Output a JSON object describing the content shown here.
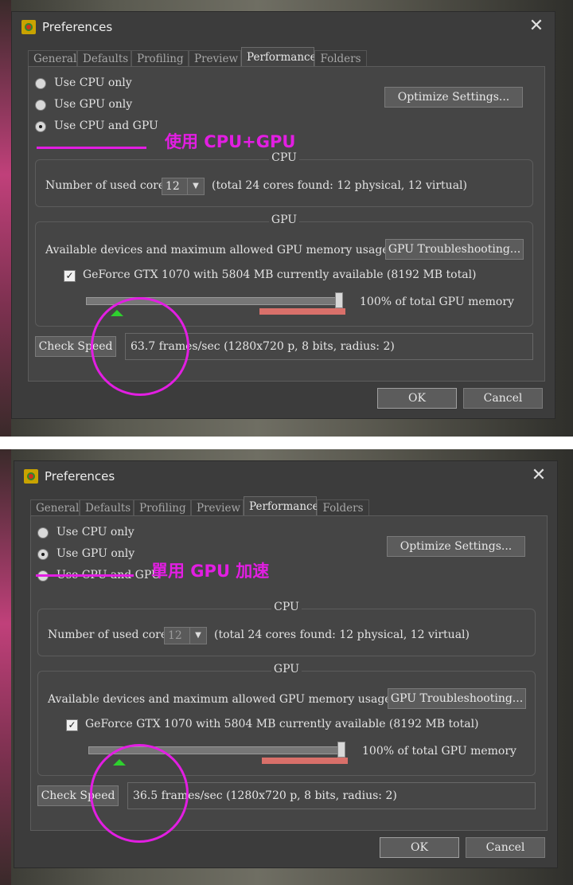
{
  "panels": [
    {
      "title": "Preferences",
      "tabs": [
        "General",
        "Defaults",
        "Profiling",
        "Preview",
        "Performance",
        "Folders"
      ],
      "active_tab": "Performance",
      "radios": [
        "Use CPU only",
        "Use GPU only",
        "Use CPU and GPU"
      ],
      "selected_radio": 2,
      "optimize_label": "Optimize Settings...",
      "cpu_group_title": "CPU",
      "cores_label": "Number of used cores:",
      "cores_value": "12",
      "cores_enabled": true,
      "cores_info": "(total 24 cores found: 12 physical, 12 virtual)",
      "gpu_group_title": "GPU",
      "devices_label": "Available devices and maximum allowed GPU memory usage:",
      "troubleshoot_label": "GPU Troubleshooting...",
      "gpu_device_label": "GeForce GTX 1070 with 5804 MB currently available (8192 MB total)",
      "gpu_device_checked": true,
      "memory_percent": 100,
      "memory_label": "100% of total GPU memory",
      "check_speed_label": "Check Speed",
      "speed_result": "63.7 frames/sec (1280x720 p, 8 bits, radius: 2)",
      "ok_label": "OK",
      "cancel_label": "Cancel",
      "annotation": "使用 CPU+GPU"
    },
    {
      "title": "Preferences",
      "tabs": [
        "General",
        "Defaults",
        "Profiling",
        "Preview",
        "Performance",
        "Folders"
      ],
      "active_tab": "Performance",
      "radios": [
        "Use CPU only",
        "Use GPU only",
        "Use CPU and GPU"
      ],
      "selected_radio": 1,
      "optimize_label": "Optimize Settings...",
      "cpu_group_title": "CPU",
      "cores_label": "Number of used cores:",
      "cores_value": "12",
      "cores_enabled": false,
      "cores_info": "(total 24 cores found: 12 physical, 12 virtual)",
      "gpu_group_title": "GPU",
      "devices_label": "Available devices and maximum allowed GPU memory usage:",
      "troubleshoot_label": "GPU Troubleshooting...",
      "gpu_device_label": "GeForce GTX 1070 with 5804 MB currently available (8192 MB total)",
      "gpu_device_checked": true,
      "memory_percent": 100,
      "memory_label": "100% of total GPU memory",
      "check_speed_label": "Check Speed",
      "speed_result": "36.5 frames/sec (1280x720 p, 8 bits, radius: 2)",
      "ok_label": "OK",
      "cancel_label": "Cancel",
      "annotation": "單用 GPU 加速"
    }
  ],
  "colors": {
    "annotation": "#e21ee2",
    "dialog_bg": "#3c3c3c",
    "panel_bg": "#454545",
    "memory_bar": "#d9706a",
    "slider_marker": "#2ed12e"
  }
}
